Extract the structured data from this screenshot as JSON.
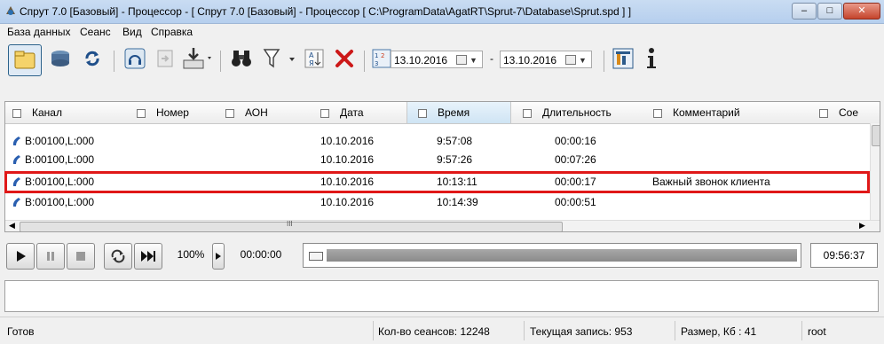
{
  "window": {
    "title": "Спрут 7.0 [Базовый] - Процессор - [ Спрут 7.0 [Базовый] - Процессор [ C:\\ProgramData\\AgatRT\\Sprut-7\\Database\\Sprut.spd ] ]",
    "minimize": "–",
    "maximize": "□",
    "close": "✕"
  },
  "menu": [
    "База данных",
    "Сеанс",
    "Вид",
    "Справка"
  ],
  "toolbar": {
    "date_from": "13.10.2016",
    "date_dash": "-",
    "date_to": "13.10.2016"
  },
  "table": {
    "columns": [
      "Канал",
      "Номер",
      "АОН",
      "Дата",
      "Время",
      "Длительность",
      "Комментарий",
      "Сое"
    ],
    "rows": [
      {
        "channel": "B:00100,L:000",
        "date": "10.10.2016",
        "time": "9:57:08",
        "duration": "00:00:16",
        "comment": ""
      },
      {
        "channel": "B:00100,L:000",
        "date": "10.10.2016",
        "time": "9:57:26",
        "duration": "00:07:26",
        "comment": ""
      },
      {
        "channel": "B:00100,L:000",
        "date": "10.10.2016",
        "time": "10:13:11",
        "duration": "00:00:17",
        "comment": "Важный звонок клиента"
      },
      {
        "channel": "B:00100,L:000",
        "date": "10.10.2016",
        "time": "10:14:39",
        "duration": "00:00:51",
        "comment": ""
      }
    ],
    "hscroll_grip": "III"
  },
  "player": {
    "volume": "100%",
    "position": "00:00:00",
    "total": "09:56:37"
  },
  "status": {
    "ready": "Готов",
    "sessions": "Кол-во сеансов: 12248",
    "current": "Текущая запись: 953",
    "size": "Размер, Кб : 41",
    "user": "root"
  },
  "colors": {
    "highlight_box": "#e01818",
    "title_gradient": "#b6cfee"
  }
}
